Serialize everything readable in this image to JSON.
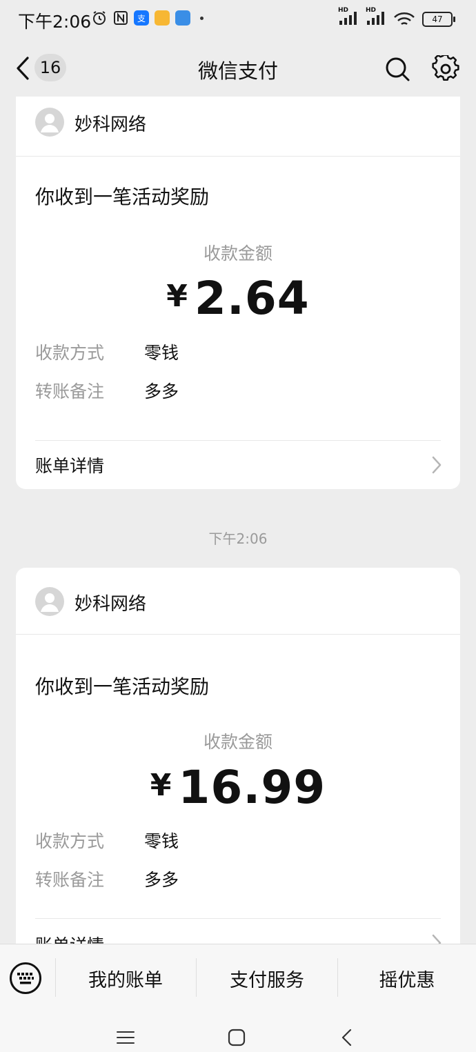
{
  "status_bar": {
    "time": "下午2:06",
    "battery": "47",
    "signal1_label": "HD",
    "signal2_label": "HD"
  },
  "nav": {
    "badge": "16",
    "title": "微信支付"
  },
  "cards": [
    {
      "merchant": "妙科网络",
      "title": "你收到一笔活动奖励",
      "amount_label": "收款金额",
      "currency": "¥",
      "amount": "2.64",
      "rows": [
        {
          "label": "收款方式",
          "value": "零钱"
        },
        {
          "label": "转账备注",
          "value": "多多"
        }
      ],
      "detail_label": "账单详情"
    },
    {
      "merchant": "妙科网络",
      "title": "你收到一笔活动奖励",
      "amount_label": "收款金额",
      "currency": "¥",
      "amount": "16.99",
      "rows": [
        {
          "label": "收款方式",
          "value": "零钱"
        },
        {
          "label": "转账备注",
          "value": "多多"
        }
      ],
      "detail_label": "账单详情"
    }
  ],
  "timestamp": "下午2:06",
  "bottom_menu": {
    "items": [
      "我的账单",
      "支付服务",
      "摇优惠"
    ]
  },
  "icons": {
    "back": "chevron-left-icon",
    "search": "search-icon",
    "settings": "gear-icon",
    "keyboard": "keyboard-icon"
  }
}
